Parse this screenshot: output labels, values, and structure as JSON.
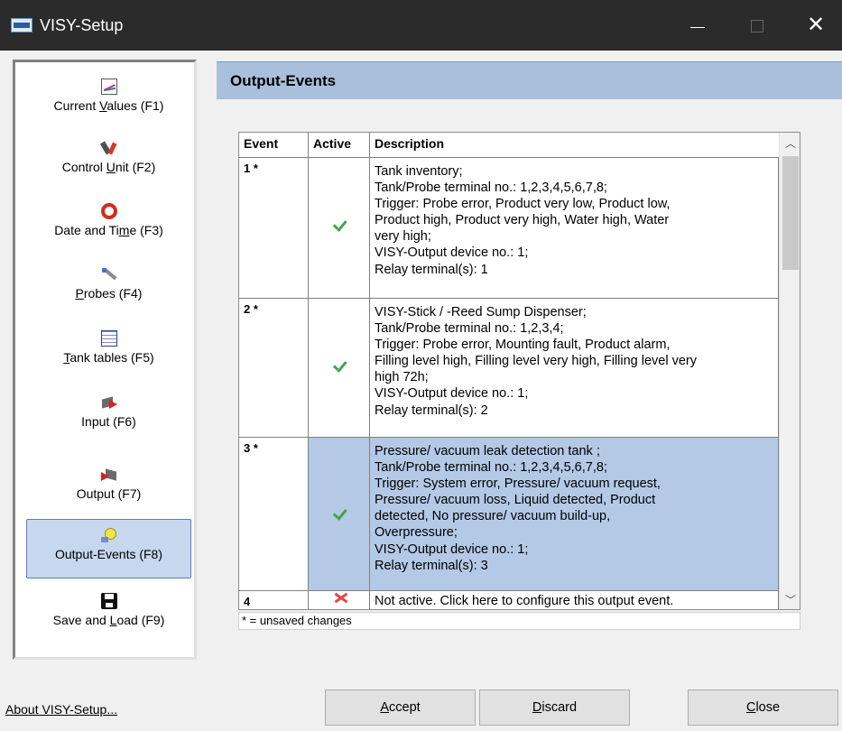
{
  "window": {
    "title": "VISY-Setup"
  },
  "sidebar": {
    "items": [
      {
        "label_pre": "Current ",
        "label_u": "V",
        "label_post": "alues (F1)",
        "icon": "chart-icon"
      },
      {
        "label_pre": "Control ",
        "label_u": "U",
        "label_post": "nit (F2)",
        "icon": "tools-icon"
      },
      {
        "label_pre": "Date and Ti",
        "label_u": "m",
        "label_post": "e (F3)",
        "icon": "alarm-clock-icon"
      },
      {
        "label_pre": "",
        "label_u": "P",
        "label_post": "robes (F4)",
        "icon": "probe-icon"
      },
      {
        "label_pre": "",
        "label_u": "T",
        "label_post": "ank tables (F5)",
        "icon": "table-icon"
      },
      {
        "label_pre": "Input (F6)",
        "label_u": "",
        "label_post": "",
        "icon": "input-arrow-icon"
      },
      {
        "label_pre": "Output (F7)",
        "label_u": "",
        "label_post": "",
        "icon": "output-arrow-icon"
      },
      {
        "label_pre": "Output-Events (F8)",
        "label_u": "",
        "label_post": "",
        "icon": "lightbulb-icon",
        "active": true
      },
      {
        "label_pre": "Save and ",
        "label_u": "L",
        "label_post": "oad (F9)",
        "icon": "save-disk-icon"
      }
    ]
  },
  "panel": {
    "title": "Output-Events"
  },
  "table": {
    "headers": [
      "Event",
      "Active",
      "Description"
    ],
    "rows": [
      {
        "event": "1 *",
        "active": true,
        "description": "Tank inventory;\nTank/Probe terminal no.: 1,2,3,4,5,6,7,8;\nTrigger: Probe error, Product very low, Product low,\nProduct high, Product very high, Water high, Water\nvery high;\nVISY-Output device no.: 1;\nRelay terminal(s): 1"
      },
      {
        "event": "2 *",
        "active": true,
        "description": "VISY-Stick / -Reed Sump Dispenser;\nTank/Probe terminal no.: 1,2,3,4;\nTrigger: Probe error, Mounting fault, Product alarm,\nFilling level high, Filling level very high, Filling level very\nhigh 72h;\nVISY-Output device no.: 1;\nRelay terminal(s): 2"
      },
      {
        "event": "3 *",
        "active": true,
        "selected": true,
        "description": "Pressure/ vacuum leak detection tank ;\nTank/Probe terminal no.: 1,2,3,4,5,6,7,8;\nTrigger: System error, Pressure/ vacuum request,\nPressure/ vacuum loss, Liquid detected, Product\ndetected, No pressure/ vacuum build-up,\nOverpressure;\nVISY-Output device no.: 1;\nRelay terminal(s): 3"
      },
      {
        "event": "4",
        "active": false,
        "description": "Not active. Click here to configure this output event."
      }
    ]
  },
  "footnote": "* = unsaved changes",
  "footer": {
    "about": "About VISY-Setup...",
    "accept_u": "A",
    "accept_rest": "ccept",
    "discard_u": "D",
    "discard_rest": "iscard",
    "close_u": "C",
    "close_rest": "lose"
  },
  "colors": {
    "title_bar": "#2b2b2b",
    "header_bar": "#a9c0dc",
    "selected_row": "#b4c9e6",
    "active_nav": "#c6d7ee",
    "check_green": "#3ea64a",
    "cross_red": "#e04848"
  }
}
